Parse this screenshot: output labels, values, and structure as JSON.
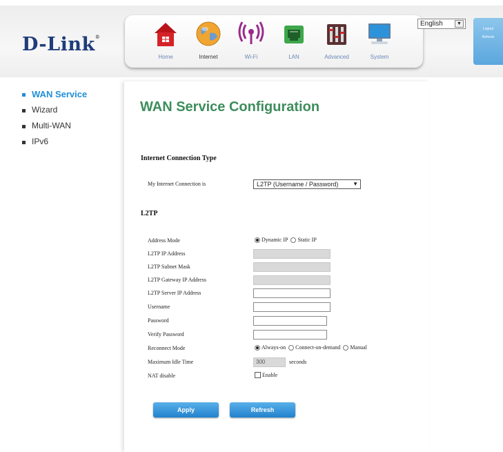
{
  "header": {
    "logo": "D-Link",
    "logo_mark": "®",
    "nav": [
      {
        "label": "Home",
        "icon": "home-icon"
      },
      {
        "label": "Internet",
        "icon": "globe-icon"
      },
      {
        "label": "Wi-Fi",
        "icon": "wifi-icon"
      },
      {
        "label": "LAN",
        "icon": "lan-icon"
      },
      {
        "label": "Advanced",
        "icon": "advanced-icon"
      },
      {
        "label": "System",
        "icon": "system-icon"
      }
    ],
    "active_nav": "Internet",
    "language": "English",
    "logout": "Logout",
    "refresh": "Refresh"
  },
  "menu": {
    "items": [
      "WAN Service",
      "Wizard",
      "Multi-WAN",
      "IPv6"
    ],
    "active": "WAN Service"
  },
  "main": {
    "title": "WAN Service Configuration",
    "conn_section": "Internet Connection Type",
    "conn_label": "My Internet Connection is",
    "conn_value": "L2TP (Username / Password)",
    "l2tp_section": "L2TP",
    "address_mode_label": "Address Mode",
    "address_mode_options": [
      "Dynamic IP",
      "Static IP"
    ],
    "address_mode_selected": "Dynamic IP",
    "ip_label": "L2TP IP Address",
    "mask_label": "L2TP Subnet Mask",
    "gateway_label": "L2TP Gateway IP Address",
    "server_label": "L2TP Server IP Address",
    "username_label": "Username",
    "password_label": "Password",
    "verify_label": "Verify Password",
    "reconnect_label": "Reconnect Mode",
    "reconnect_options": [
      "Always-on",
      "Connect-on-demand",
      "Manual"
    ],
    "reconnect_selected": "Always-on",
    "idle_label": "Maximum Idle Time",
    "idle_value": "300",
    "idle_unit": "seconds",
    "nat_label": "NAT disable",
    "nat_option": "Enable",
    "nat_checked": false,
    "apply": "Apply",
    "refresh": "Refresh"
  },
  "colors": {
    "brand": "#1f3d7a",
    "title_green": "#3d8d5c",
    "menu_active": "#1f8fd8",
    "button": "#2f8fd8"
  }
}
